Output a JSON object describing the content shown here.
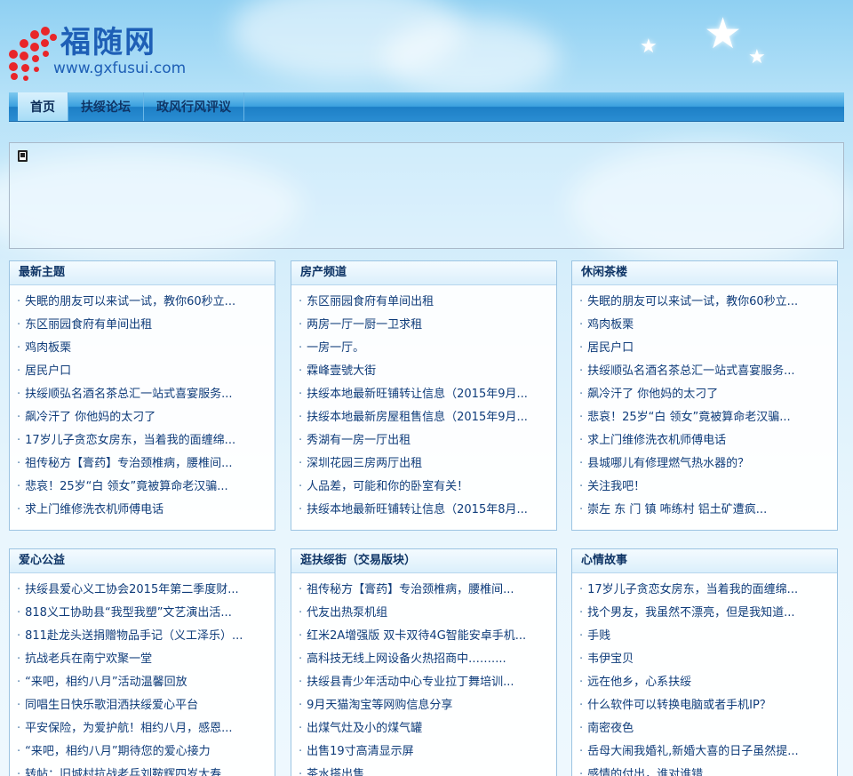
{
  "site": {
    "name": "福随网",
    "url": "www.gxfusui.com"
  },
  "nav": {
    "items": [
      "首页",
      "扶绥论坛",
      "政风行风评议"
    ]
  },
  "panels": [
    {
      "title": "最新主题",
      "items": [
        "失眠的朋友可以来试一试，教你60秒立...",
        "东区丽园食府有单间出租",
        "鸡肉板栗",
        "居民户口",
        "扶绥顺弘名酒名茶总汇一站式喜宴服务...",
        "飙冷汗了 你他妈的太刁了",
        "17岁儿子贪恋女房东，当着我的面缠绵...",
        "祖传秘方【膏药】专治颈椎病，腰椎间...",
        "悲哀！25岁“白 领女”竟被算命老汉骗...",
        "求上门维修洗衣机师傅电话"
      ]
    },
    {
      "title": "房产频道",
      "items": [
        "东区丽园食府有单间出租",
        "两房一厅一厨一卫求租",
        "一房一厅。",
        "霖峰壹號大街",
        "扶绥本地最新旺铺转让信息（2015年9月...",
        "扶绥本地最新房屋租售信息（2015年9月...",
        "秀湖有一房一厅出租",
        "深圳花园三房两厅出租",
        "人品差，可能和你的卧室有关！",
        "扶绥本地最新旺铺转让信息（2015年8月..."
      ]
    },
    {
      "title": "休闲茶楼",
      "items": [
        "失眠的朋友可以来试一试，教你60秒立...",
        "鸡肉板栗",
        "居民户口",
        "扶绥顺弘名酒名茶总汇一站式喜宴服务...",
        "飙冷汗了 你他妈的太刁了",
        "悲哀！25岁“白 领女”竟被算命老汉骗...",
        "求上门维修洗衣机师傅电话",
        "县城哪儿有修理燃气热水器的？",
        "关注我吧！",
        "崇左 东 门 镇 咘练村 铝土矿遭疯..."
      ]
    },
    {
      "title": "爱心公益",
      "items": [
        "扶绥县爱心义工协会2015年第二季度财...",
        "818义工协助县“我型我塑”文艺演出活...",
        "811赴龙头送捐赠物品手记（义工泽乐）...",
        "抗战老兵在南宁欢聚一堂",
        "“来吧，相约八月”活动温馨回放",
        "同唱生日快乐歌泪洒扶绥爱心平台",
        "平安保险，为爱护航！相约八月，感恩...",
        "“来吧，相约八月”期待您的爱心接力",
        "转帖：旧城村抗战老兵刘鞍辉四岁大寿..."
      ]
    },
    {
      "title": "逛扶绥街（交易版块）",
      "items": [
        "祖传秘方【膏药】专治颈椎病，腰椎间...",
        "代友出热泵机组",
        "红米2A增强版 双卡双待4G智能安卓手机...",
        "高科技无线上网设备火热招商中.……...",
        "扶绥县青少年活动中心专业拉丁舞培训...",
        "9月天猫淘宝等网购信息分享",
        "出煤气灶及小的煤气罐",
        "出售19寸高清显示屏",
        "茶水搭出售"
      ]
    },
    {
      "title": "心情故事",
      "items": [
        "17岁儿子贪恋女房东，当着我的面缠绵...",
        "找个男友，我虽然不漂亮，但是我知道...",
        "手贱",
        "韦伊宝贝",
        "远在他乡，心系扶绥",
        "什么软件可以转换电脑或者手机IP？",
        "南密夜色",
        "岳母大闹我婚礼,新婚大喜的日子虽然提...",
        "感情的付出，谁对谁错"
      ]
    }
  ]
}
